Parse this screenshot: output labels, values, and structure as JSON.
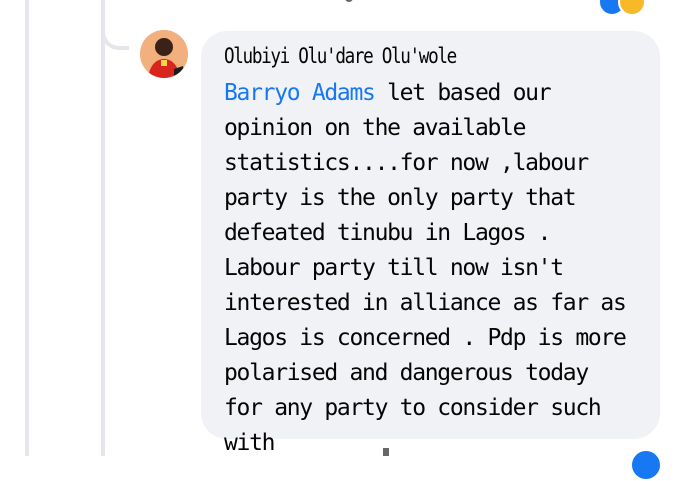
{
  "comment": {
    "author": "Olubiyi Olu'dare Olu'wole",
    "mention": "Barryo Adams",
    "text": " let based our opinion on the available statistics....for now ,labour party is the only party that defeated tinubu in Lagos . Labour party till now isn't interested in alliance as far as Lagos is concerned . Pdp is more polarised and dangerous today for any party to consider such with"
  },
  "colors": {
    "mention": "#1877f2",
    "bubble_bg": "#f0f2f5",
    "thread_line": "#e4e6eb",
    "like_reaction": "#1877f2",
    "love_reaction": "#f7b928"
  },
  "icons": {
    "avatar": "user-avatar",
    "reactions": [
      "like-icon",
      "love-icon"
    ]
  }
}
